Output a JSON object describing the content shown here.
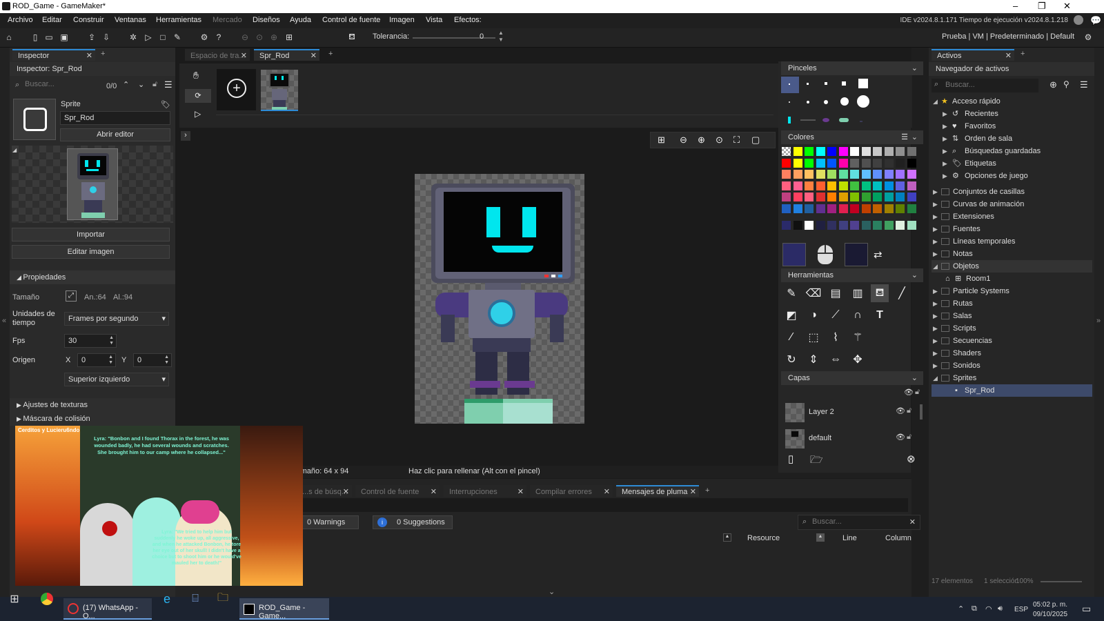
{
  "window": {
    "title": "ROD_Game - GameMaker*",
    "minimize": "–",
    "restore": "❐",
    "close": "✕"
  },
  "menu": {
    "items": [
      "Archivo",
      "Editar",
      "Construir",
      "Ventanas",
      "Herramientas",
      "Mercado",
      "Diseños",
      "Ayuda",
      "Control de fuente",
      "Imagen",
      "Vista",
      "Efectos:"
    ],
    "version": "IDE v2024.8.1.171  Tiempo de ejecución v2024.8.1.218"
  },
  "toolbar": {
    "tolerance_label": "Tolerancia:",
    "tolerance_value": "0",
    "target": "Prueba | VM | Predeterminado | Default"
  },
  "inspector": {
    "tab": "Inspector",
    "title": "Inspector: Spr_Rod",
    "search_placeholder": "Buscar...",
    "search_count": "0/0",
    "type_label": "Sprite",
    "name": "Spr_Rod",
    "open_editor": "Abrir editor",
    "import_btn": "Importar",
    "edit_image_btn": "Editar imagen",
    "props_header": "Propiedades",
    "size_label": "Tamaño",
    "width": "An.:64",
    "height": "Al.:94",
    "time_units_label": "Unidades de tiempo",
    "time_units_value": "Frames por segundo",
    "fps_label": "Fps",
    "fps_value": "30",
    "origin_label": "Origen",
    "origin_x_label": "X",
    "origin_x": "0",
    "origin_y_label": "Y",
    "origin_y": "0",
    "origin_preset": "Superior izquierdo",
    "texture_settings": "Ajustes de texturas",
    "collision_mask": "Máscara de colisión"
  },
  "overlay": {
    "title": "Cerditos y Lucieru6ndo",
    "text_top": "Lyra: \"Bonbon and I found Thorax in the forest, he was wounded badly, he had several wounds and scratches. She brought him to our camp where he collapsed...\"",
    "text_bottom": "Lyra: \"We tried to help him but suddenly he woke up, all aggressive, and when he attacked Bonbon, he tore her eye out of her skull! I didn't have a choice but to shoot him or he would've mauled her to death!\""
  },
  "editor": {
    "tabs": [
      {
        "label": "Espacio de tra...",
        "active": false
      },
      {
        "label": "Spr_Rod",
        "active": true
      }
    ],
    "status_size": "Tamaño: 64 x 94",
    "status_hint": "Haz clic para rellenar (Alt con el pincel)"
  },
  "output": {
    "tabs": [
      {
        "label": "...s de búsq..."
      },
      {
        "label": "Control de fuente"
      },
      {
        "label": "Interrupciones"
      },
      {
        "label": "Compilar errores"
      },
      {
        "label": "Mensajes de pluma"
      }
    ],
    "warnings": "0 Warnings",
    "suggestions": "0 Suggestions",
    "search_placeholder": "Buscar...",
    "columns": [
      "Resource",
      "Line",
      "Column"
    ]
  },
  "brushes": {
    "header": "Pinceles"
  },
  "colors": {
    "header": "Colores",
    "palette": [
      [
        "#ffffff00",
        "#ffff00",
        "#00ff00",
        "#00ffff",
        "#0000ff",
        "#ff00ff",
        "#ffffff",
        "#e0e0e0",
        "#c8c8c8",
        "#b0b0b0",
        "#909090",
        "#707070"
      ],
      [
        "#ff0000",
        "#ffff00",
        "#00ff00",
        "#00bfff",
        "#0055ff",
        "#ff00aa",
        "#606060",
        "#505050",
        "#404040",
        "#303030",
        "#202020",
        "#000000"
      ],
      [
        "#ff8060",
        "#ffa060",
        "#ffc060",
        "#e0e060",
        "#a0e060",
        "#60e0a0",
        "#60e0e0",
        "#60c0ff",
        "#6090ff",
        "#8080ff",
        "#a070ff",
        "#d070ff"
      ],
      [
        "#ff6080",
        "#ff6090",
        "#ff8040",
        "#ff6030",
        "#ffc000",
        "#c0e000",
        "#40c040",
        "#00c080",
        "#00c0c0",
        "#0090e0",
        "#6060e0",
        "#c060c0"
      ],
      [
        "#c04080",
        "#ff4060",
        "#ff6080",
        "#e03030",
        "#ff8000",
        "#e0a000",
        "#80c000",
        "#30a030",
        "#00a060",
        "#00a0a0",
        "#0080c0",
        "#4040c0"
      ],
      [
        "#2060c0",
        "#2080e0",
        "#2060a0",
        "#603090",
        "#a02080",
        "#e02050",
        "#c00020",
        "#c04000",
        "#c06000",
        "#a08000",
        "#608000",
        "#208040"
      ],
      [
        "#2a2a6a",
        "#101010",
        "#ffffff",
        "#202040",
        "#303060",
        "#404080",
        "#504090",
        "#2a6060",
        "#2a8060",
        "#40a060",
        "#e0f0e0",
        "#a0e0c0"
      ]
    ],
    "primary": "#2b2b66",
    "secondary": "#1a1a33"
  },
  "tools": {
    "header": "Herramientas"
  },
  "layers": {
    "header": "Capas",
    "items": [
      {
        "name": "Layer 2"
      },
      {
        "name": "default"
      }
    ]
  },
  "assets": {
    "tab": "Activos",
    "title": "Navegador de activos",
    "search_placeholder": "Buscar...",
    "quick_access": "Acceso rápido",
    "quick_items": [
      "Recientes",
      "Favoritos",
      "Orden de sala",
      "Búsquedas guardadas",
      "Etiquetas",
      "Opciones de juego"
    ],
    "groups": [
      "Conjuntos de casillas",
      "Curvas de animación",
      "Extensiones",
      "Fuentes",
      "Líneas temporales",
      "Notas",
      "Objetos",
      "Room1",
      "Particle Systems",
      "Rutas",
      "Salas",
      "Scripts",
      "Secuencias",
      "Shaders",
      "Sonidos",
      "Sprites",
      "Spr_Rod"
    ],
    "footer_count": "17 elementos",
    "footer_sel": "1 selección",
    "footer_zoom": "100%"
  },
  "taskbar": {
    "whatsapp": "(17) WhatsApp - O...",
    "gamemaker": "ROD_Game - Game...",
    "lang": "ESP",
    "time": "05:02 p. m.",
    "date": "09/10/2025"
  }
}
